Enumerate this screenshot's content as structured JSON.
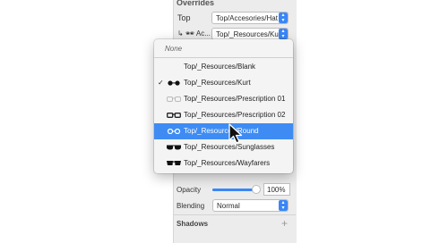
{
  "overrides": {
    "title": "Overrides",
    "top_label": "Top",
    "top_value": "Top/Accesories/Hat",
    "sub_label": "↳ 🕶 Ac...",
    "sub_value": "Top/_Resources/Kurt"
  },
  "dropdown": {
    "none_label": "None",
    "items": [
      {
        "label": "Top/_Resources/Blank",
        "icon": "blank"
      },
      {
        "label": "Top/_Resources/Kurt",
        "icon": "sunglasses-round-icon",
        "checked": true
      },
      {
        "label": "Top/_Resources/Prescription 01",
        "icon": "glasses-light-icon"
      },
      {
        "label": "Top/_Resources/Prescription 02",
        "icon": "glasses-rect-icon"
      },
      {
        "label": "Top/_Resources/Round",
        "icon": "glasses-round-icon",
        "selected": true
      },
      {
        "label": "Top/_Resources/Sunglasses",
        "icon": "sunglasses-icon"
      },
      {
        "label": "Top/_Resources/Wayfarers",
        "icon": "wayfarers-icon"
      }
    ],
    "check_mark": "✓"
  },
  "appearance": {
    "opacity_label": "Opacity",
    "opacity_value": "100%",
    "opacity_level": 1.0,
    "blending_label": "Blending",
    "blending_value": "Normal"
  },
  "shadows": {
    "label": "Shadows",
    "add": "+"
  },
  "colors": {
    "accent": "#3a86f5",
    "selection": "#3e8cf3"
  }
}
